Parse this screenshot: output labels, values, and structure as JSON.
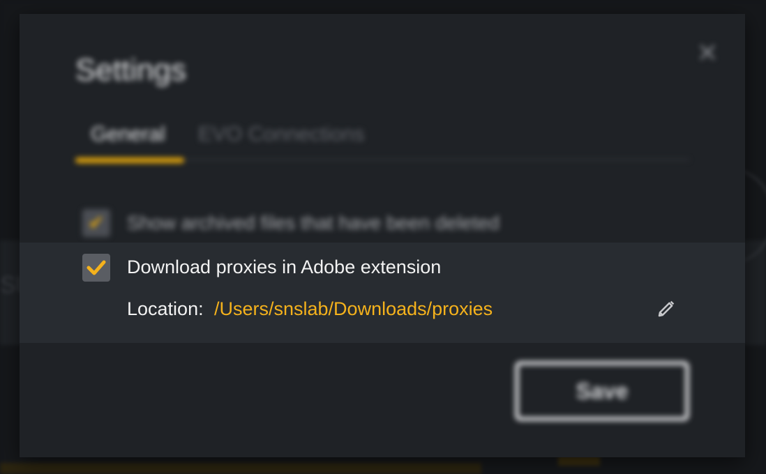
{
  "dialog": {
    "title": "Settings",
    "close_icon": "close-icon",
    "tabs": [
      {
        "label": "General",
        "active": true
      },
      {
        "label": "EVO Connections",
        "active": false
      }
    ],
    "accent_color": "#e0a40d",
    "options": {
      "show_archived": {
        "label": "Show archived files that have been deleted",
        "checked": true
      },
      "download_proxies": {
        "label": "Download proxies in Adobe extension",
        "checked": true,
        "location_label": "Location:",
        "location_value": "/Users/snslab/Downloads/proxies",
        "edit_icon": "pencil-icon"
      }
    },
    "save_label": "Save"
  },
  "colors": {
    "location_text": "#f5b21c",
    "highlight_bg": "#282c31",
    "dialog_bg": "#1f2226"
  }
}
